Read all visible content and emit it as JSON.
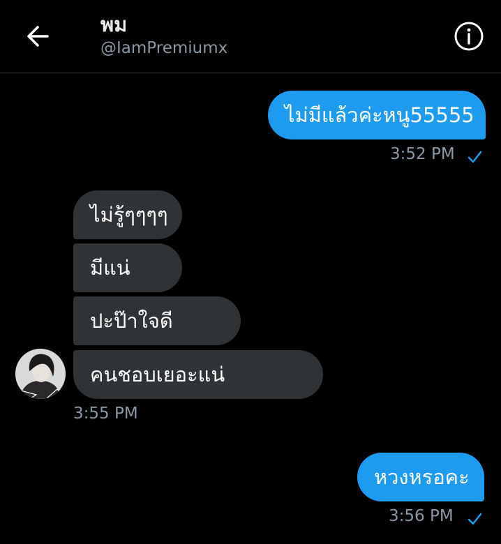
{
  "header": {
    "name": "พม",
    "handle": "@IamPremiumx",
    "back_icon": "arrow-left-icon",
    "info_icon": "info-icon"
  },
  "messages": [
    {
      "direction": "out",
      "text": "ไม่มีแล้วค่ะหนู55555",
      "time": "3:52 PM",
      "read": true
    },
    {
      "direction": "in",
      "text": "ไม่รู้ๆๆๆๆ"
    },
    {
      "direction": "in",
      "text": "มีแน่"
    },
    {
      "direction": "in",
      "text": "ปะป๊าใจดี"
    },
    {
      "direction": "in",
      "text": "คนชอบเยอะแน่",
      "time": "3:55 PM"
    },
    {
      "direction": "out",
      "text": "หวงหรอคะ",
      "time": "3:56 PM",
      "read": true
    }
  ],
  "colors": {
    "background": "#000000",
    "outgoing_bubble": "#1d9bf0",
    "incoming_bubble": "#2f3336",
    "secondary_text": "#8b98a5"
  }
}
